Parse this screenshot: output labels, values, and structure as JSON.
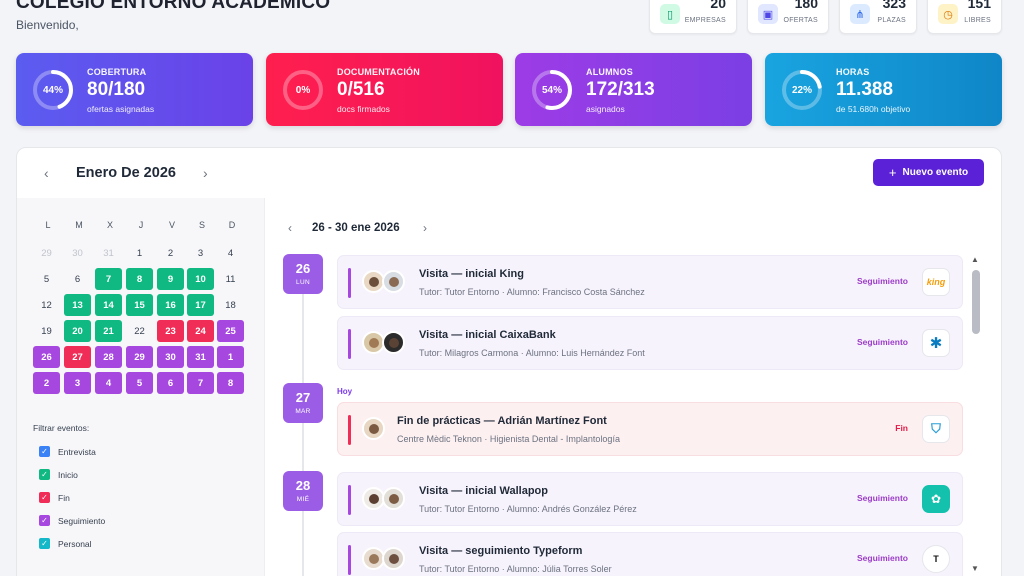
{
  "header": {
    "title": "COLEGIO ENTORNO ACADÉMICO",
    "subtitle": "Bienvenido,"
  },
  "stats": [
    {
      "value": "20",
      "label": "EMPRESAS",
      "icon": "building-icon",
      "color": "#10b981"
    },
    {
      "value": "180",
      "label": "OFERTAS",
      "icon": "briefcase-icon",
      "color": "#6366f1"
    },
    {
      "value": "323",
      "label": "PLAZAS",
      "icon": "network-icon",
      "color": "#3b82f6"
    },
    {
      "value": "151",
      "label": "LIBRES",
      "icon": "clock-icon",
      "color": "#f59e0b"
    }
  ],
  "kpis": [
    {
      "label": "COBERTURA",
      "value": "80/180",
      "sub": "ofertas asignadas",
      "pct_text": "44%",
      "pct": 0.44
    },
    {
      "label": "DOCUMENTACIÓN",
      "value": "0/516",
      "sub": "docs firmados",
      "pct_text": "0%",
      "pct": 0.0
    },
    {
      "label": "ALUMNOS",
      "value": "172/313",
      "sub": "asignados",
      "pct_text": "54%",
      "pct": 0.54
    },
    {
      "label": "HORAS",
      "value": "11.388",
      "sub": "de 51.680h objetivo",
      "pct_text": "22%",
      "pct": 0.22
    }
  ],
  "calendar": {
    "month_title": "Enero De 2026",
    "new_event_label": "Nuevo evento",
    "weekdays": [
      "L",
      "M",
      "X",
      "J",
      "V",
      "S",
      "D"
    ],
    "weeks": [
      [
        {
          "d": "29",
          "s": "out"
        },
        {
          "d": "30",
          "s": "out"
        },
        {
          "d": "31",
          "s": "out"
        },
        {
          "d": "1",
          "s": "plain"
        },
        {
          "d": "2",
          "s": "plain"
        },
        {
          "d": "3",
          "s": "plain"
        },
        {
          "d": "4",
          "s": "plain"
        }
      ],
      [
        {
          "d": "5",
          "s": "plain"
        },
        {
          "d": "6",
          "s": "plain"
        },
        {
          "d": "7",
          "s": "g"
        },
        {
          "d": "8",
          "s": "g"
        },
        {
          "d": "9",
          "s": "g"
        },
        {
          "d": "10",
          "s": "g"
        },
        {
          "d": "11",
          "s": "plain"
        }
      ],
      [
        {
          "d": "12",
          "s": "plain"
        },
        {
          "d": "13",
          "s": "g"
        },
        {
          "d": "14",
          "s": "g"
        },
        {
          "d": "15",
          "s": "g"
        },
        {
          "d": "16",
          "s": "g"
        },
        {
          "d": "17",
          "s": "g"
        },
        {
          "d": "18",
          "s": "plain"
        }
      ],
      [
        {
          "d": "19",
          "s": "plain"
        },
        {
          "d": "20",
          "s": "g"
        },
        {
          "d": "21",
          "s": "g"
        },
        {
          "d": "22",
          "s": "plain"
        },
        {
          "d": "23",
          "s": "r"
        },
        {
          "d": "24",
          "s": "r"
        },
        {
          "d": "25",
          "s": "p"
        }
      ],
      [
        {
          "d": "26",
          "s": "p"
        },
        {
          "d": "27",
          "s": "r"
        },
        {
          "d": "28",
          "s": "p"
        },
        {
          "d": "29",
          "s": "p"
        },
        {
          "d": "30",
          "s": "p"
        },
        {
          "d": "31",
          "s": "p"
        },
        {
          "d": "1",
          "s": "p"
        }
      ],
      [
        {
          "d": "2",
          "s": "p"
        },
        {
          "d": "3",
          "s": "p"
        },
        {
          "d": "4",
          "s": "p"
        },
        {
          "d": "5",
          "s": "p"
        },
        {
          "d": "6",
          "s": "p"
        },
        {
          "d": "7",
          "s": "p"
        },
        {
          "d": "8",
          "s": "p"
        }
      ]
    ]
  },
  "filters": {
    "title": "Filtrar eventos:",
    "items": [
      {
        "label": "Entrevista",
        "color": "#3b82f6"
      },
      {
        "label": "Inicio",
        "color": "#10b981"
      },
      {
        "label": "Fin",
        "color": "#ef2d56"
      },
      {
        "label": "Seguimiento",
        "color": "#a647e0"
      },
      {
        "label": "Personal",
        "color": "#14b8c8"
      }
    ]
  },
  "week": {
    "range": "26 - 30 ene 2026",
    "today_label": "Hoy",
    "days": [
      {
        "num": "26",
        "dow": "LUN"
      },
      {
        "num": "27",
        "dow": "MAR"
      },
      {
        "num": "28",
        "dow": "MIÉ"
      }
    ],
    "events": [
      {
        "title": "Visita — inicial King",
        "sub": "Tutor: Tutor Entorno · Alumno: Francisco Costa Sánchez",
        "tag": "Seguimiento",
        "logo": "king"
      },
      {
        "title": "Visita — inicial CaixaBank",
        "sub": "Tutor: Milagros Carmona · Alumno: Luis Hernández Font",
        "tag": "Seguimiento",
        "logo": "caixabank"
      },
      {
        "title": "Fin de prácticas — Adrián Martínez Font",
        "sub": "Centre Mèdic Teknon · Higienista Dental - Implantología",
        "tag": "Fin",
        "logo": "teknon"
      },
      {
        "title": "Visita — inicial Wallapop",
        "sub": "Tutor: Tutor Entorno · Alumno: Andrés González Pérez",
        "tag": "Seguimiento",
        "logo": "wallapop"
      },
      {
        "title": "Visita — seguimiento Typeform",
        "sub": "Tutor: Tutor Entorno · Alumno: Júlia Torres Soler",
        "tag": "Seguimiento",
        "logo": "T"
      }
    ]
  },
  "colors": {
    "kpi1": [
      "#5b5cf0",
      "#6a42e8"
    ],
    "kpi2": [
      "#ff1f4e",
      "#f0125f"
    ],
    "kpi3": [
      "#9d3ce6",
      "#7b3fe4"
    ],
    "kpi4": [
      "#19a4e0",
      "#0f86c7"
    ],
    "seguimiento": "#9b3cc8",
    "fin": "#e11d48"
  }
}
